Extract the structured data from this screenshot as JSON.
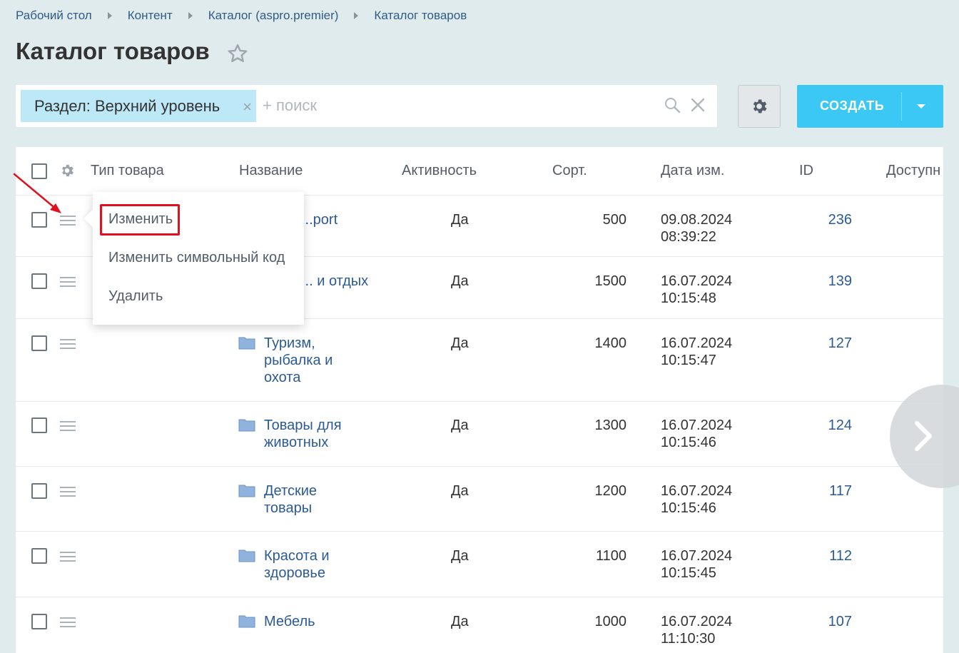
{
  "breadcrumb": [
    "Рабочий стол",
    "Контент",
    "Каталог (aspro.premier)",
    "Каталог товаров"
  ],
  "page_title": "Каталог товаров",
  "filter": {
    "tag": "Раздел: Верхний уровень",
    "search_placeholder": "+ поиск"
  },
  "create_button": "СОЗДАТЬ",
  "columns": [
    "Тип товара",
    "Название",
    "Активность",
    "Сорт.",
    "Дата изм.",
    "ID",
    "Доступн"
  ],
  "rows": [
    {
      "name": "...port",
      "active": "Да",
      "sort": "500",
      "date": "09.08.2024",
      "time": "08:39:22",
      "id": "236"
    },
    {
      "name": "... и отдых",
      "active": "Да",
      "sort": "1500",
      "date": "16.07.2024",
      "time": "10:15:48",
      "id": "139"
    },
    {
      "name": "Туризм, рыбалка и охота",
      "active": "Да",
      "sort": "1400",
      "date": "16.07.2024",
      "time": "10:15:47",
      "id": "127"
    },
    {
      "name": "Товары для животных",
      "active": "Да",
      "sort": "1300",
      "date": "16.07.2024",
      "time": "10:15:46",
      "id": "124"
    },
    {
      "name": "Детские товары",
      "active": "Да",
      "sort": "1200",
      "date": "16.07.2024",
      "time": "10:15:46",
      "id": "117"
    },
    {
      "name": "Красота и здоровье",
      "active": "Да",
      "sort": "1100",
      "date": "16.07.2024",
      "time": "10:15:45",
      "id": "112"
    },
    {
      "name": "Мебель",
      "active": "Да",
      "sort": "1000",
      "date": "16.07.2024",
      "time": "11:10:30",
      "id": "107"
    }
  ],
  "context_menu": [
    "Изменить",
    "Изменить символьный код",
    "Удалить"
  ],
  "colors": {
    "accent": "#3bc8f5",
    "tag": "#bde8f7",
    "link": "#2b5a94",
    "highlight": "#e0101e"
  }
}
